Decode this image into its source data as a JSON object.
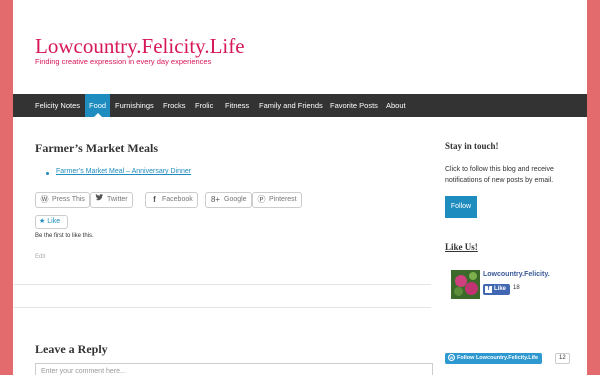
{
  "site": {
    "title": "Lowcountry.Felicity.Life",
    "tagline": "Finding creative expression in every day experiences"
  },
  "nav": {
    "items": [
      {
        "label": "Felicity Notes"
      },
      {
        "label": "Food"
      },
      {
        "label": "Furnishings"
      },
      {
        "label": "Frocks"
      },
      {
        "label": "Frolic"
      },
      {
        "label": "Fitness"
      },
      {
        "label": "Family and Friends"
      },
      {
        "label": "Favorite Posts"
      },
      {
        "label": "About"
      }
    ],
    "active": "Food"
  },
  "post": {
    "title": "Farmer’s Market Meals",
    "links": [
      {
        "label": "Farmer’s Market Meal – Anniversary Dinner"
      }
    ]
  },
  "share": {
    "buttons": [
      {
        "label": "Press This",
        "icon": "wordpress-icon"
      },
      {
        "label": "Twitter",
        "icon": "twitter-icon"
      },
      {
        "label": "Facebook",
        "icon": "facebook-icon"
      },
      {
        "label": "Google",
        "icon": "google-plus-icon"
      },
      {
        "label": "Pinterest",
        "icon": "pinterest-icon"
      }
    ]
  },
  "like": {
    "button_label": "Like",
    "first_text": "Be the first to like this."
  },
  "edit_label": "Edit",
  "reply": {
    "title": "Leave a Reply",
    "placeholder": "Enter your comment here..."
  },
  "sidebar": {
    "stay_title": "Stay in touch!",
    "stay_text": "Click to follow this blog and receive notifications of new posts by email.",
    "follow_label": "Follow",
    "like_title": "Like Us!",
    "fb_page_name": "Lowcountry.Felicity.",
    "fb_like_label": "Like",
    "fb_like_count": "18",
    "wp_follow_label": "Follow Lowcountry.Felicity.Life",
    "wp_follow_count": "12"
  },
  "colors": {
    "background": "#e46b6d",
    "accent": "#d6175a",
    "link": "#1e8cbe",
    "nav_bar": "#333333"
  }
}
